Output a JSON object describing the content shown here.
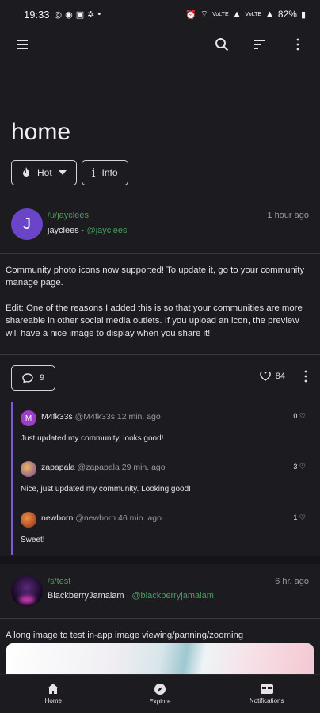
{
  "status_bar": {
    "time": "19:33",
    "battery": "82%",
    "signal_small_1": "VoLTE",
    "signal_small_2": "VoLTE"
  },
  "app_bar": {
    "menu_icon": "hamburger-menu-icon",
    "search_icon": "search-icon",
    "sort_icon": "sort-icon",
    "more_icon": "more-vert-icon"
  },
  "page": {
    "title": "home"
  },
  "chips": {
    "sort_label": "Hot",
    "info_label": "Info"
  },
  "post1": {
    "avatar_letter": "J",
    "community": "/u/jayclees",
    "time": "1 hour ago",
    "author": "jayclees",
    "handle": "@jayclees",
    "body_p1": "Community photo icons now supported! To update it, go to your community manage page.",
    "body_p2": "Edit: One of the reasons I added this is so that your communities are more shareable in other social media outlets. If you upload an icon, the preview will have a nice image to display when you share it!",
    "comment_count": "9",
    "like_count": "84"
  },
  "comments": [
    {
      "user": "M4fk33s",
      "meta": "@M4fk33s 12 min. ago",
      "score": "0",
      "text": "Just updated my community, looks good!",
      "avatar_color": "#9b3fc4"
    },
    {
      "user": "zapapala",
      "meta": "@zapapala 29 min. ago",
      "score": "3",
      "text": "Nice, just updated my community. Looking good!",
      "avatar_color": "#c28a3c"
    },
    {
      "user": "newborn",
      "meta": "@newborn 46 min. ago",
      "score": "1",
      "text": "Sweet!",
      "avatar_color": "#d4622c"
    }
  ],
  "post2": {
    "community": "/s/test",
    "time": "6 hr. ago",
    "author": "BlackberryJamalam",
    "handle": "@blackberryjamalam",
    "title": "A long image to test in-app image viewing/panning/zooming"
  },
  "bottom_nav": [
    {
      "label": "Home",
      "icon": "home-icon"
    },
    {
      "label": "Explore",
      "icon": "explore-compass-icon"
    },
    {
      "label": "Notifications",
      "icon": "notifications-inbox-icon"
    }
  ],
  "colors": {
    "background": "#1c1b1f",
    "accent_green": "#4b9a62",
    "thread_line": "#7a5dd6",
    "avatar_purple": "#6a45c9"
  }
}
